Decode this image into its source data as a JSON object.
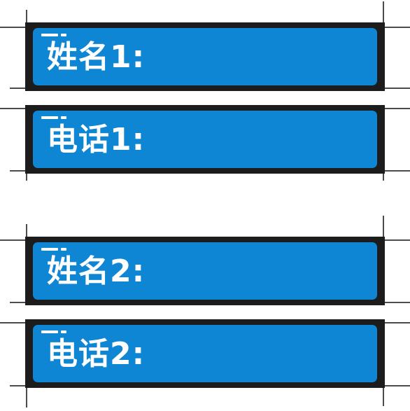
{
  "cards": [
    {
      "label": "姓名1:"
    },
    {
      "label": "电话1:"
    },
    {
      "label": "姓名2:"
    },
    {
      "label": "电话2:"
    }
  ],
  "colors": {
    "panel_blue": "#0e86d4",
    "frame": "#1c1c1c",
    "background": "#ffffff",
    "text": "#ffffff"
  }
}
